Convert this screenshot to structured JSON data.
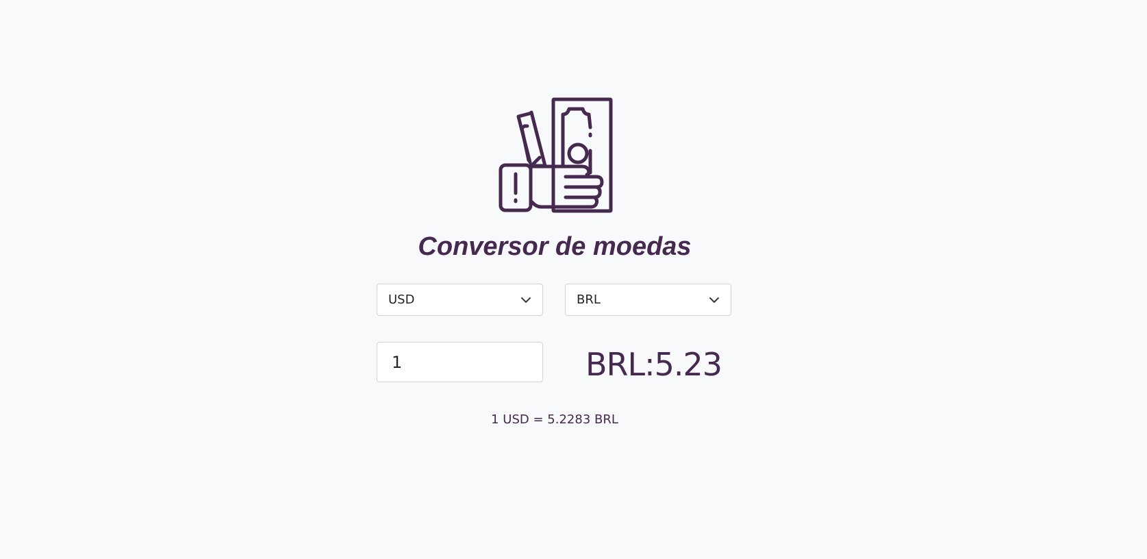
{
  "app": {
    "title": "Conversor de moedas",
    "logo_icon": "hand-holding-money-icon",
    "accent_color": "#45294f"
  },
  "converter": {
    "from_currency": "USD",
    "to_currency": "BRL",
    "amount": "1",
    "result": "BRL:5.23",
    "rate_text": "1 USD = 5.2283 BRL"
  }
}
